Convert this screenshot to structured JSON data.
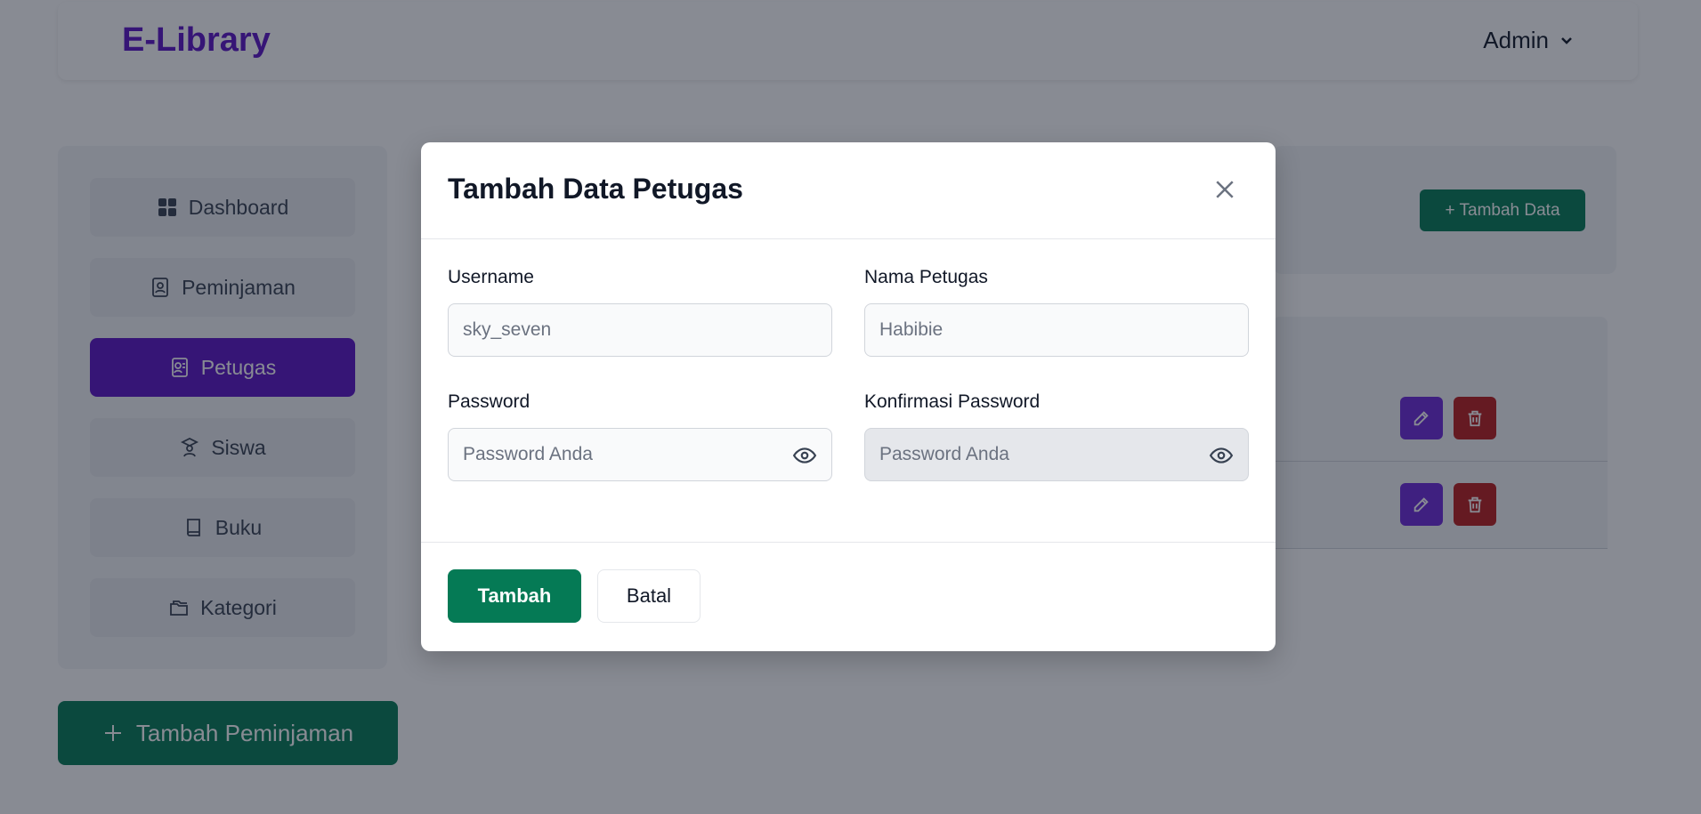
{
  "app": {
    "brand": "E-Library",
    "user_menu_label": "Admin"
  },
  "sidebar": {
    "items": [
      {
        "label": "Dashboard",
        "icon": "grid-icon"
      },
      {
        "label": "Peminjaman",
        "icon": "contact-book-icon"
      },
      {
        "label": "Petugas",
        "icon": "staff-badge-icon",
        "active": true
      },
      {
        "label": "Siswa",
        "icon": "student-icon"
      },
      {
        "label": "Buku",
        "icon": "book-icon"
      },
      {
        "label": "Kategori",
        "icon": "folders-icon"
      }
    ],
    "add_loan_label": "Tambah Peminjaman"
  },
  "content": {
    "add_data_label": "+ Tambah Data"
  },
  "modal": {
    "title": "Tambah Data Petugas",
    "fields": {
      "username": {
        "label": "Username",
        "placeholder": "sky_seven"
      },
      "nama_petugas": {
        "label": "Nama Petugas",
        "placeholder": "Habibie"
      },
      "password": {
        "label": "Password",
        "placeholder": "Password Anda"
      },
      "konfirmasi_password": {
        "label": "Konfirmasi Password",
        "placeholder": "Password Anda"
      }
    },
    "submit_label": "Tambah",
    "cancel_label": "Batal"
  },
  "colors": {
    "brand": "#5b13c4",
    "primary_green": "#057a55",
    "edit_purple": "#6d28d9",
    "delete_red": "#b91c1c"
  }
}
